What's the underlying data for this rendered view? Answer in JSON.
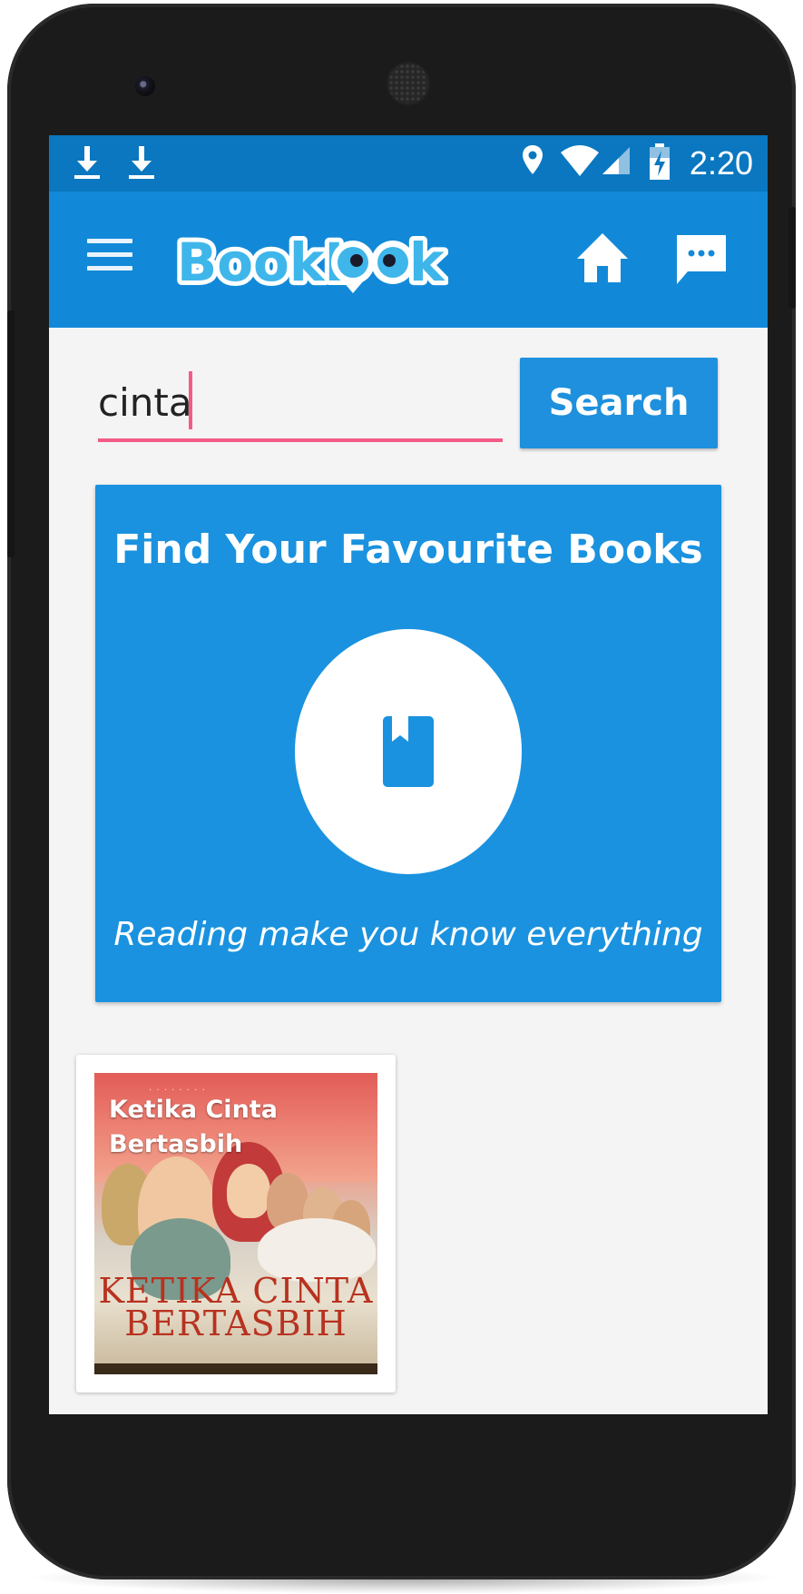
{
  "status_bar": {
    "time": "2:20",
    "icons": [
      "download-icon",
      "download-icon",
      "location-icon",
      "wifi-icon",
      "signal-icon",
      "battery-charging-icon"
    ]
  },
  "app_bar": {
    "logo_text": "BookLOOk",
    "icons": [
      "menu-icon",
      "home-icon",
      "chat-icon"
    ],
    "colors": {
      "status": "#0a77c0",
      "bar": "#1289d8",
      "accent": "#f35b86"
    }
  },
  "search": {
    "value": "cinta",
    "button_label": "Search"
  },
  "hero": {
    "title": "Find Your Favourite Books",
    "icon": "bookmark-book-icon",
    "tagline": "Reading make you know everything"
  },
  "results": [
    {
      "title": "Ketika Cinta Bertasbih",
      "cover_art_title": "KETIKA CINTA BERTASBIH"
    }
  ]
}
